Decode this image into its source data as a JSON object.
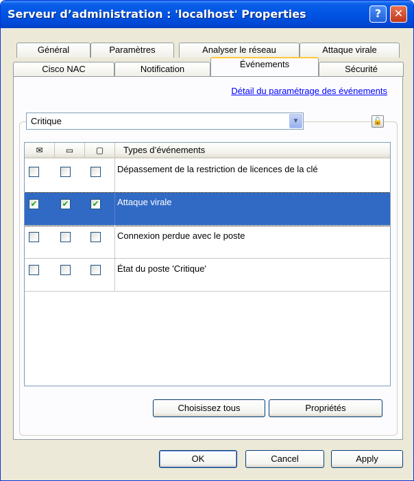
{
  "window": {
    "title": "Serveur d’administration : 'localhost' Properties",
    "help_label": "?",
    "close_label": "✕"
  },
  "tabs_row1": [
    {
      "label": "Général"
    },
    {
      "label": "Paramètres"
    },
    {
      "label": "Analyser le réseau"
    },
    {
      "label": "Attaque virale"
    }
  ],
  "tabs_row2": [
    {
      "label": "Cisco NAC"
    },
    {
      "label": "Notification"
    },
    {
      "label": "Événements",
      "active": true
    },
    {
      "label": "Sécurité"
    }
  ],
  "panel": {
    "link_label": "Détail du paramétrage des événements",
    "severity_value": "Critique",
    "combo_arrow": "▼",
    "lock_icon": "🔓"
  },
  "list": {
    "columns": {
      "col1_icon": "✉",
      "col2_icon": "▭",
      "col3_icon": "▢",
      "types_header": "Types d’événements"
    },
    "rows": [
      {
        "label": "Dépassement de la restriction de licences de la clé",
        "checked": [
          false,
          false,
          false
        ],
        "selected": false
      },
      {
        "label": "Attaque virale",
        "checked": [
          true,
          true,
          true
        ],
        "selected": true
      },
      {
        "label": "Connexion perdue avec le poste",
        "checked": [
          false,
          false,
          false
        ],
        "selected": false
      },
      {
        "label": "État du poste 'Critique'",
        "checked": [
          false,
          false,
          false
        ],
        "selected": false
      }
    ]
  },
  "buttons": {
    "select_all": "Choisissez tous",
    "properties": "Propriétés",
    "ok": "OK",
    "cancel": "Cancel",
    "apply": "Apply"
  },
  "colors": {
    "selection": "#316ac5",
    "titlebar": "#0054e3",
    "check": "#21a121"
  }
}
